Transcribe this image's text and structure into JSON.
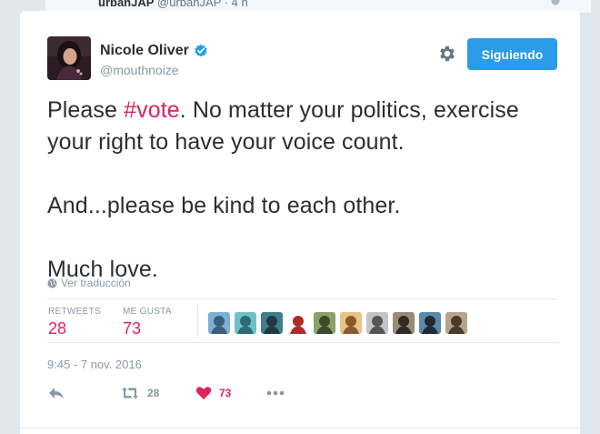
{
  "background_tweet": {
    "name": "urbanJAP",
    "handle": "@urbanJAP",
    "time": "· 4 h"
  },
  "tweet": {
    "author": {
      "name": "Nicole Oliver",
      "handle": "@mouthnoize",
      "verified": true
    },
    "follow_button": "Siguiendo",
    "text_before_hashtag": "Please ",
    "hashtag": "#vote",
    "text_after_hashtag": ". No matter your politics, exercise your right to have your voice count.\n\nAnd...please be kind to each other.\n\nMuch love.",
    "translate_label": "Ver traducción",
    "stats": {
      "retweets_label": "RETWEETS",
      "retweets_count": "28",
      "likes_label": "ME GUSTA",
      "likes_count": "73"
    },
    "timestamp": "9:45 - 7 nov. 2016",
    "actions": {
      "retweet_count": "28",
      "like_count": "73"
    }
  },
  "colors": {
    "accent": "#2b9ce8",
    "like": "#e0245e",
    "muted": "#8899a6",
    "text": "#292f33",
    "page_bg": "#e1e8ed"
  },
  "icons": {
    "verified": "verified-badge-icon",
    "gear": "gear-icon",
    "globe": "globe-icon",
    "reply": "reply-icon",
    "retweet": "retweet-icon",
    "like": "heart-icon",
    "more": "more-dots-icon"
  },
  "likers": [
    {
      "name": "liker-1",
      "c1": "#7cb0d6",
      "c2": "#3a5f7a"
    },
    {
      "name": "liker-2",
      "c1": "#6fc1c9",
      "c2": "#2c6b74"
    },
    {
      "name": "liker-3",
      "c1": "#3f7f8c",
      "c2": "#1d3a40"
    },
    {
      "name": "liker-4",
      "c1": "#ffffff",
      "c2": "#b02a2a"
    },
    {
      "name": "liker-5",
      "c1": "#8aa16a",
      "c2": "#3d4a2a"
    },
    {
      "name": "liker-6",
      "c1": "#e8c48a",
      "c2": "#8a5a2a"
    },
    {
      "name": "liker-7",
      "c1": "#c4c4c4",
      "c2": "#555555"
    },
    {
      "name": "liker-8",
      "c1": "#9a8a7a",
      "c2": "#2e2a26"
    },
    {
      "name": "liker-9",
      "c1": "#5a8aa8",
      "c2": "#1f2a33"
    },
    {
      "name": "liker-10",
      "c1": "#b8a48e",
      "c2": "#4a3a2e"
    }
  ]
}
